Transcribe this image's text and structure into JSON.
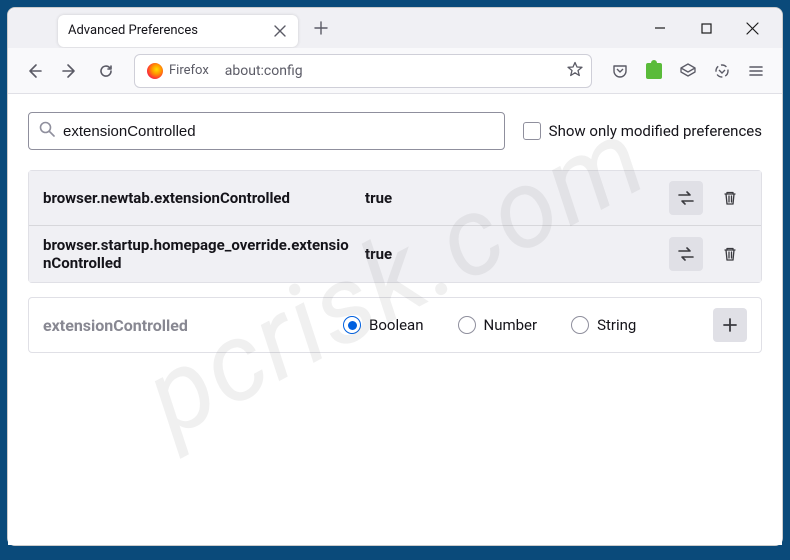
{
  "tab": {
    "title": "Advanced Preferences"
  },
  "toolbar": {
    "identity": "Firefox",
    "url": "about:config"
  },
  "search": {
    "value": "extensionControlled",
    "showOnlyModified": "Show only modified preferences"
  },
  "prefs": [
    {
      "name": "browser.newtab.extensionControlled",
      "value": "true"
    },
    {
      "name": "browser.startup.homepage_override.extensionControlled",
      "value": "true"
    }
  ],
  "addRow": {
    "name": "extensionControlled",
    "types": {
      "boolean": "Boolean",
      "number": "Number",
      "string": "String"
    }
  },
  "watermark": "pcrisk.com"
}
